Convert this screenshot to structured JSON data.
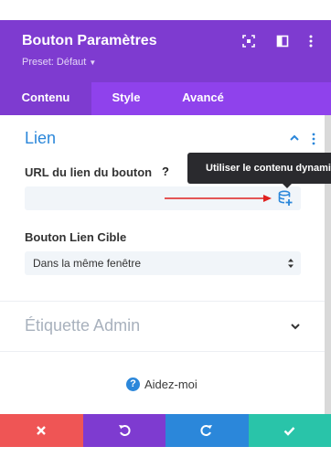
{
  "header": {
    "title": "Bouton Paramètres",
    "preset": "Preset: Défaut",
    "icons": [
      "expand-icon",
      "split-view-icon",
      "more-vertical-icon"
    ]
  },
  "tabs": [
    {
      "label": "Contenu",
      "active": true
    },
    {
      "label": "Style",
      "active": false
    },
    {
      "label": "Avancé",
      "active": false
    }
  ],
  "lien": {
    "title": "Lien",
    "url_label": "URL du lien du bouton",
    "url_value": "",
    "tooltip": "Utiliser le contenu dynamique",
    "target_label": "Bouton Lien Cible",
    "target_value": "Dans la même fenêtre"
  },
  "admin": {
    "title": "Étiquette Admin"
  },
  "help": {
    "label": "Aidez-moi"
  },
  "footer": {
    "buttons": [
      {
        "icon": "close-icon",
        "color": "#ef5555"
      },
      {
        "icon": "undo-icon",
        "color": "#7e3bd0"
      },
      {
        "icon": "redo-icon",
        "color": "#2b87da"
      },
      {
        "icon": "check-icon",
        "color": "#29c4a9"
      }
    ]
  },
  "colors": {
    "header": "#7e3bd0",
    "tabs": "#8f42ec",
    "accent": "#2b87da",
    "annotation_arrow": "#e0201f"
  }
}
